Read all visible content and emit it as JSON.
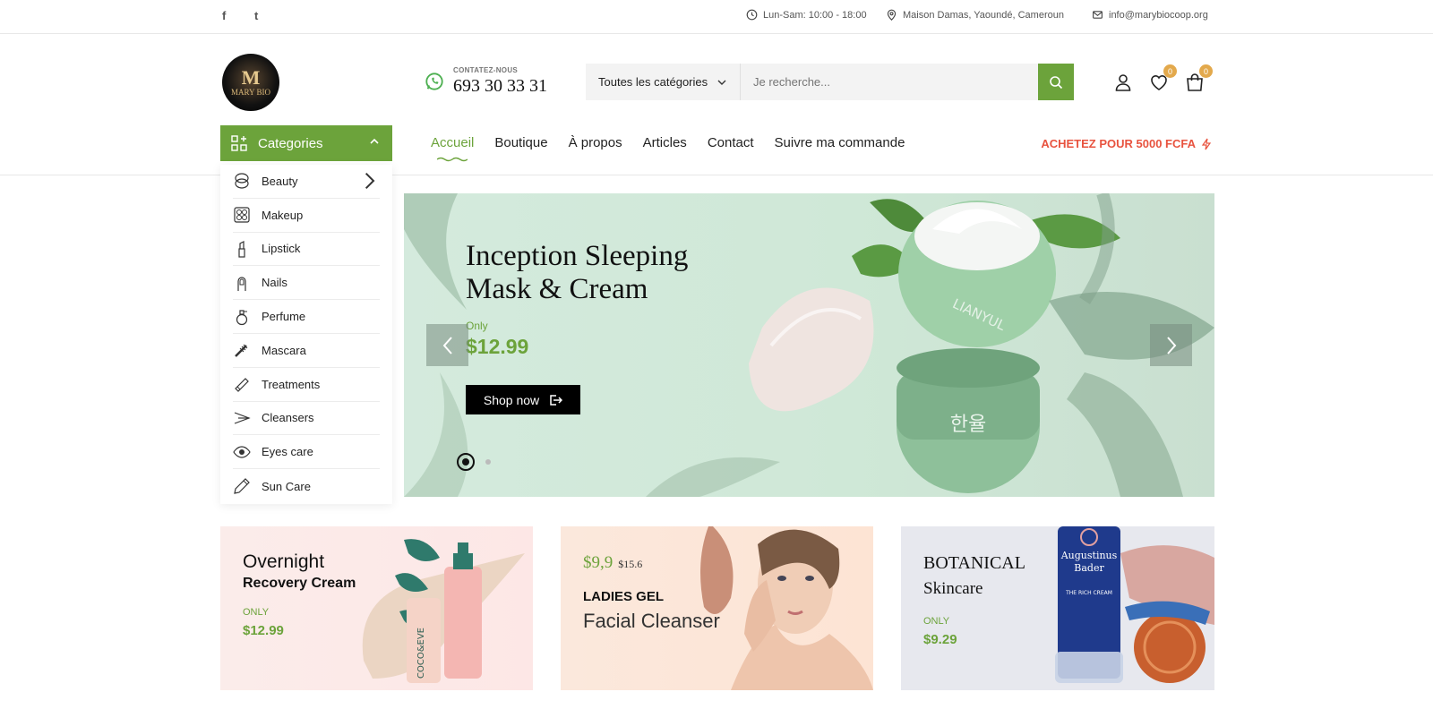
{
  "topbar": {
    "social": [
      "f",
      "t"
    ],
    "hours": "Lun-Sam: 10:00 - 18:00",
    "address": "Maison Damas, Yaoundé, Cameroun",
    "email": "info@marybiocoop.org"
  },
  "logo": {
    "monogram": "M",
    "text": "MARY BIO"
  },
  "contact": {
    "label": "CONTATEZ-NOUS",
    "phone": "693 30 33 31"
  },
  "search": {
    "category": "Toutes les catégories",
    "placeholder": "Je recherche..."
  },
  "header_icons": {
    "wishlist_count": "0",
    "cart_count": "0"
  },
  "categories_button": "Categories",
  "nav": {
    "items": [
      "Accueil",
      "Boutique",
      "À propos",
      "Articles",
      "Contact",
      "Suivre ma commande"
    ],
    "active": "Accueil",
    "promo": "ACHETEZ POUR 5000 FCFA"
  },
  "category_list": [
    "Beauty",
    "Makeup",
    "Lipstick",
    "Nails",
    "Perfume",
    "Mascara",
    "Treatments",
    "Cleansers",
    "Eyes care",
    "Sun Care"
  ],
  "hero": {
    "title_line1": "Inception Sleeping",
    "title_line2": "Mask & Cream",
    "only": "Only",
    "price": "$12.99",
    "cta": "Shop now",
    "jar_text_top": "LIANYUL",
    "jar_text_bottom": "한율"
  },
  "banners": [
    {
      "title": "Overnight",
      "subtitle": "Recovery Cream",
      "only": "ONLY",
      "price": "$12.99",
      "product_text": "COCO&EVE"
    },
    {
      "price_new": "$9,9",
      "price_old": "$15.6",
      "title": "LADIES GEL",
      "subtitle": "Facial Cleanser"
    },
    {
      "title": "BOTANICAL",
      "subtitle": "Skincare",
      "only": "ONLY",
      "price": "$9.29",
      "product_text_1": "Augustinus",
      "product_text_2": "Bader",
      "product_text_3": "THE RICH CREAM"
    }
  ],
  "colors": {
    "accent": "#6ca33b",
    "promo": "#e8533f",
    "badge": "#e3a94c"
  }
}
